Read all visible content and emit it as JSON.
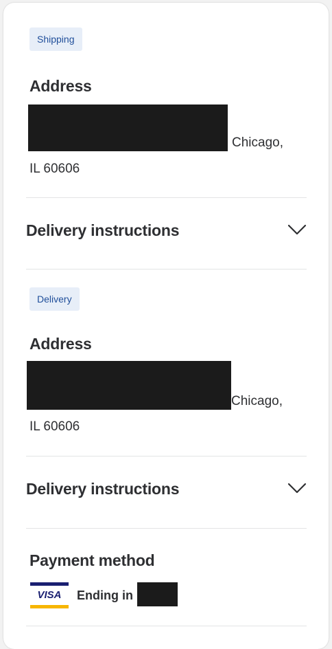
{
  "shipping": {
    "tag": "Shipping",
    "address_heading": "Address",
    "city_line": "Chicago,",
    "zip_line": "IL 60606",
    "instructions_label": "Delivery instructions"
  },
  "delivery": {
    "tag": "Delivery",
    "address_heading": "Address",
    "city_line": "Chicago,",
    "zip_line": "IL 60606",
    "instructions_label": "Delivery instructions"
  },
  "payment": {
    "heading": "Payment method",
    "card_brand": "VISA",
    "ending_label": "Ending in"
  },
  "icons": {
    "chevron": "chevron-down-icon",
    "card": "visa-card-icon"
  },
  "colors": {
    "tag_bg": "#e7eef8",
    "tag_text": "#1f4e9a",
    "visa_blue": "#1a1f71",
    "visa_gold": "#f7b600"
  }
}
